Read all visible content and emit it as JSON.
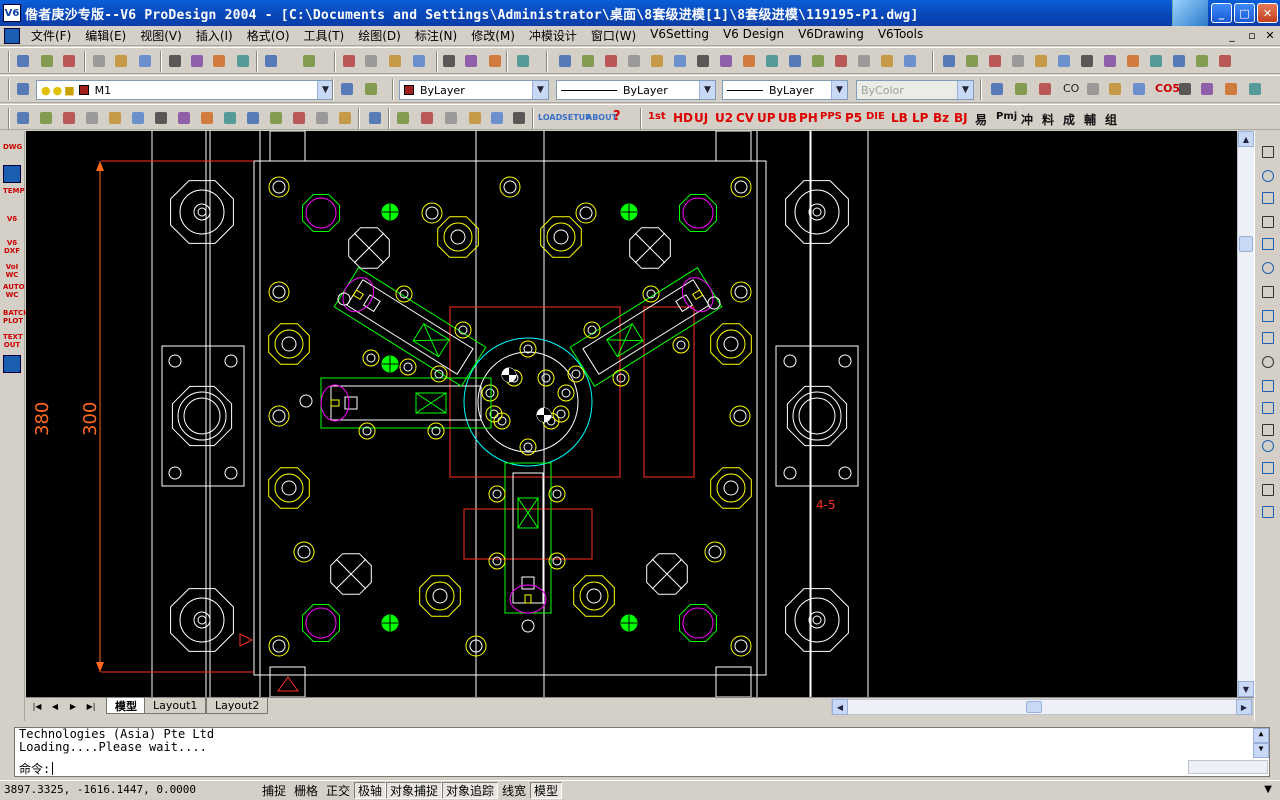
{
  "window": {
    "title": "偺者庚沙专版--V6 ProDesign 2004 - [C:\\Documents and Settings\\Administrator\\桌面\\8套级进模[1]\\8套级进模\\119195-P1.dwg]",
    "app_badge": "V6",
    "minimize_glyph": "_",
    "maximize_glyph": "□",
    "close_glyph": "✕"
  },
  "menu": {
    "items": [
      "文件(F)",
      "编辑(E)",
      "视图(V)",
      "插入(I)",
      "格式(O)",
      "工具(T)",
      "绘图(D)",
      "标注(N)",
      "修改(M)",
      "冲模设计",
      "窗口(W)",
      "V6Setting",
      "V6 Design",
      "V6Drawing",
      "V6Tools"
    ],
    "mdi_min": "_",
    "mdi_restore": "▫",
    "mdi_close": "✕"
  },
  "toolbar2": {
    "layer_value": "M1",
    "color_value": "ByLayer",
    "linetype_value": "ByLayer",
    "lineweight_value": "ByLayer",
    "plotstyle_value": "ByColor",
    "text_buttons": [
      "CO",
      "CO5"
    ]
  },
  "toolbar3": {
    "load_label": "LOAD",
    "setup_label": "SETUP",
    "about_label": "ABOUT",
    "help_label": "?",
    "v6_cmds": [
      "1st",
      "HD",
      "UJ",
      "U2",
      "CV",
      "UP",
      "UB",
      "PH",
      "PPS",
      "P5",
      "DIE",
      "LB",
      "LP",
      "Bz",
      "BJ",
      "易",
      "Pmj",
      "冲",
      "料",
      "成",
      "輔",
      "组"
    ]
  },
  "left_toolbar": {
    "items": [
      "DWG",
      "",
      "TEMP",
      "V6",
      "V6 DXF",
      "VoI WC",
      "AUTO WC",
      "BATCH PLOT",
      "TEXT OUT",
      ""
    ]
  },
  "drawing": {
    "dim_380": "380",
    "dim_300": "300",
    "annotation": "4-5"
  },
  "layout_tabs": {
    "tabs": [
      "模型",
      "Layout1",
      "Layout2"
    ],
    "active": "模型"
  },
  "command": {
    "history": [
      "Technologies (Asia) Pte Ltd",
      "Loading....Please wait...."
    ],
    "prompt": "命令:"
  },
  "status": {
    "coords": "3897.3325, -1616.1447, 0.0000",
    "toggles": [
      {
        "label": "捕捉",
        "on": false
      },
      {
        "label": "栅格",
        "on": false
      },
      {
        "label": "正交",
        "on": false
      },
      {
        "label": "极轴",
        "on": true
      },
      {
        "label": "对象捕捉",
        "on": true
      },
      {
        "label": "对象追踪",
        "on": true
      },
      {
        "label": "线宽",
        "on": false
      },
      {
        "label": "模型",
        "on": true
      }
    ]
  },
  "colors": {
    "canvas": "#000000",
    "white_lines": "#ffffff",
    "yellow": "#ffff00",
    "green": "#00ff00",
    "magenta": "#ff00ff",
    "red": "#ff3020",
    "cyan": "#00ffff",
    "dimension": "#ff6a20"
  }
}
